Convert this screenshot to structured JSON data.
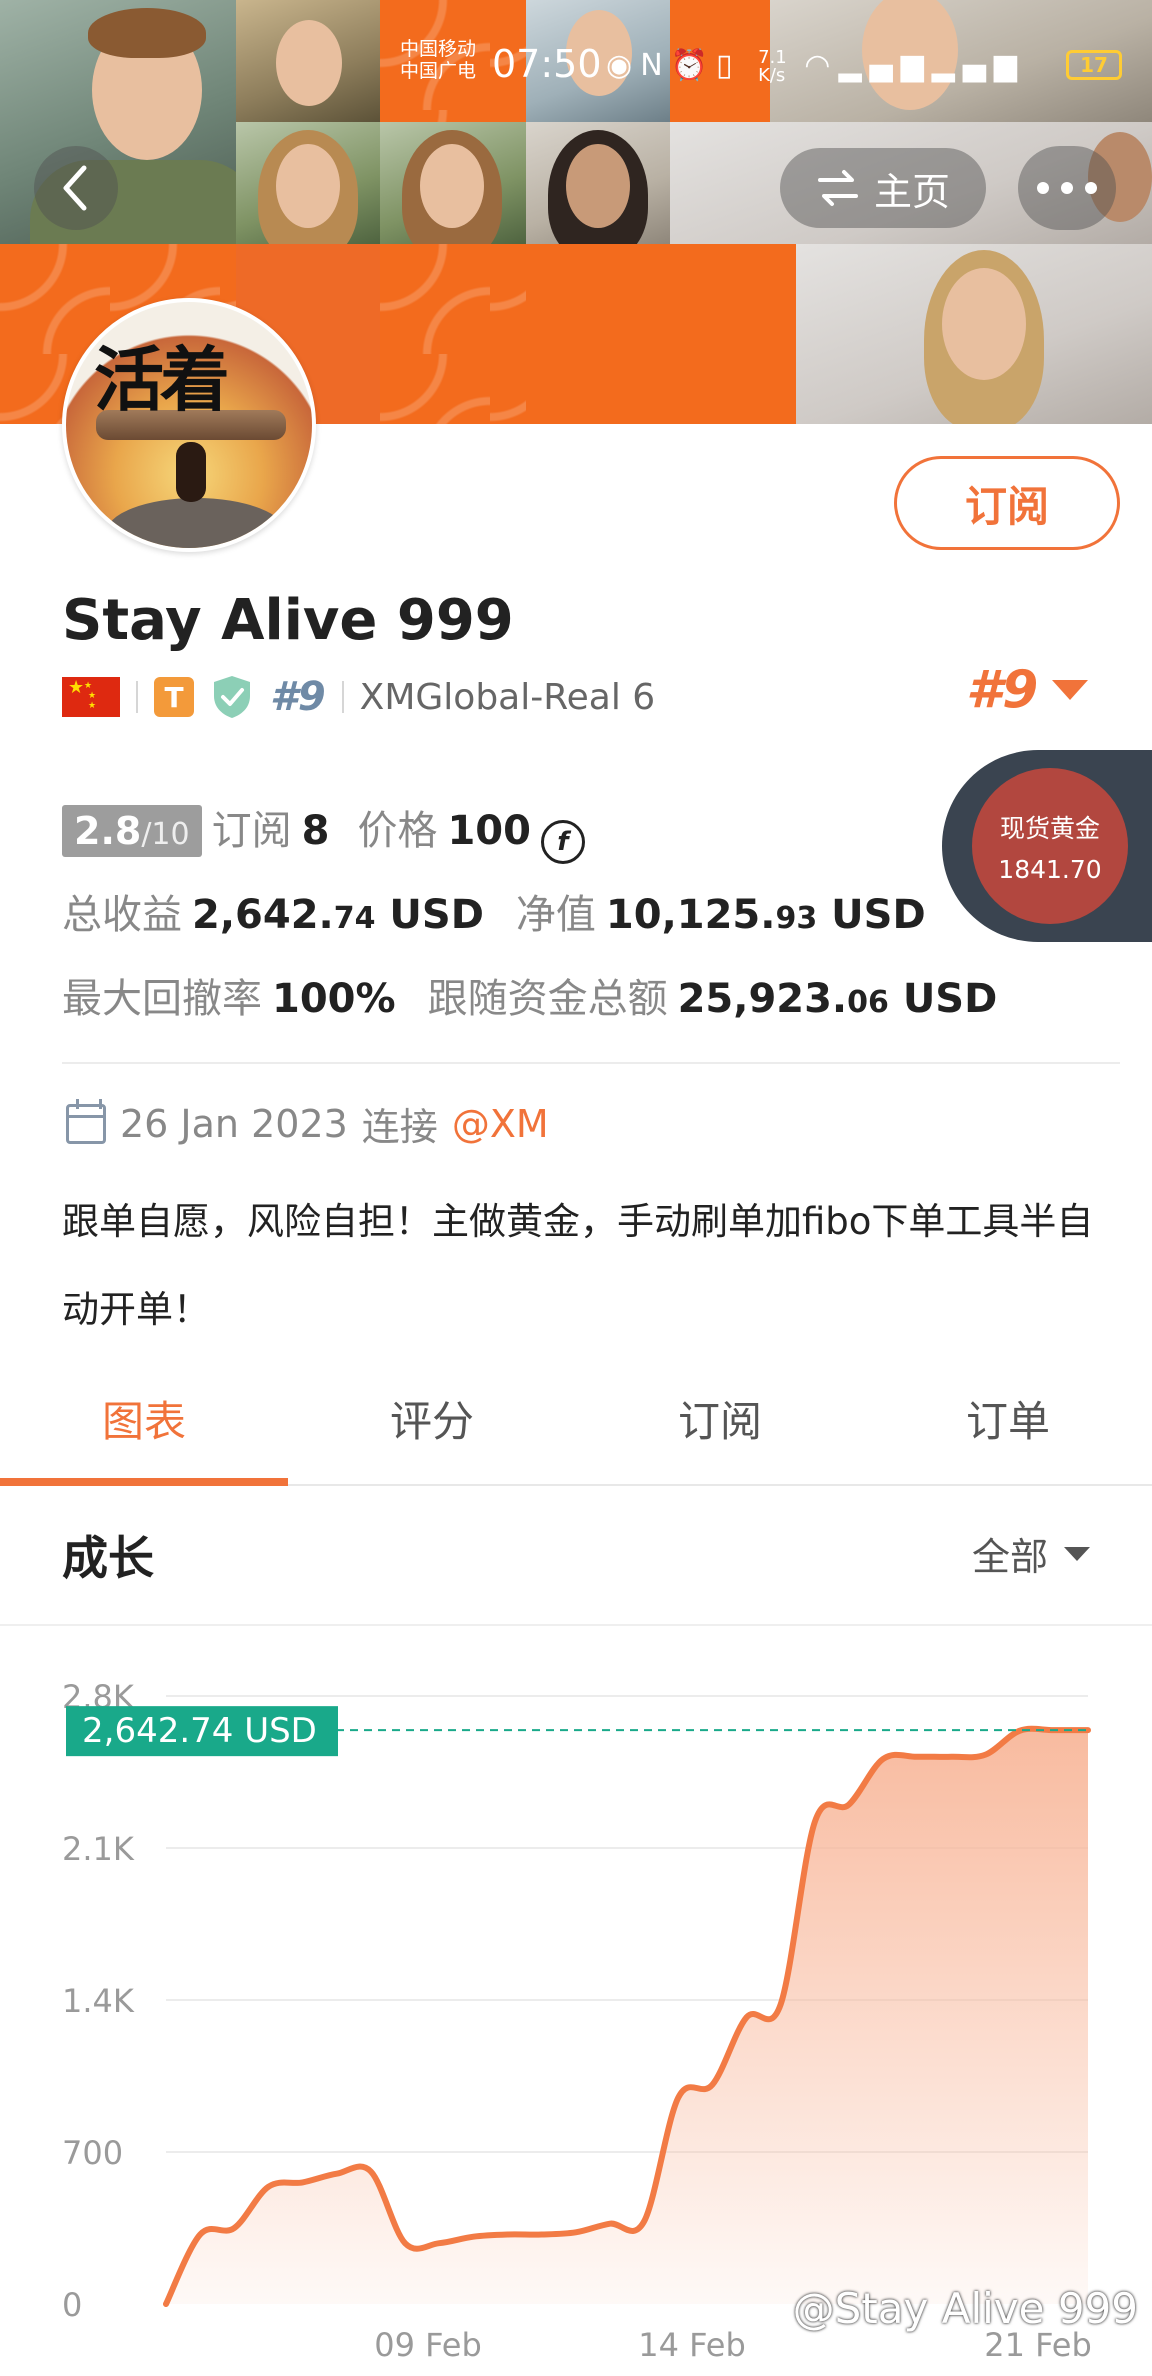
{
  "status_bar": {
    "carrier_line1": "中国移动",
    "carrier_line2": "中国广电",
    "time": "07:50",
    "net_speed": "7.1\nK/s",
    "battery": "17"
  },
  "nav": {
    "back_icon": "chevron-left-icon",
    "home_label": "主页",
    "more_icon": "more-horizontal-icon"
  },
  "profile": {
    "avatar_text": "活着",
    "subscribe_label": "订阅",
    "name": "Stay Alive 999",
    "flag": "china-flag",
    "t_badge": "T",
    "rank_small": "#9",
    "broker": "XMGlobal-Real 6",
    "rank_big": "#9"
  },
  "stats": {
    "score": "2.8",
    "score_max": "/10",
    "subscribe_label": "订阅",
    "subscribe_count": "8",
    "price_label": "价格",
    "price_value": "100",
    "coin_symbol": "f",
    "total_profit_label": "总收益",
    "total_profit_main": "2,642.",
    "total_profit_dec": "74",
    "total_profit_unit": "USD",
    "equity_label": "净值",
    "equity_main": "10,125.",
    "equity_dec": "93",
    "equity_unit": "USD",
    "drawdown_label": "最大回撤率",
    "drawdown_value": "100%",
    "follow_label": "跟随资金总额",
    "follow_main": "25,923.",
    "follow_dec": "06",
    "follow_unit": "USD"
  },
  "gold_widget": {
    "label": "现货黄金",
    "value": "1841.70"
  },
  "joined": {
    "date": "26 Jan 2023",
    "connect_label": "连接",
    "broker_link": "@XM"
  },
  "bio": "跟单自愿，风险自担！主做黄金，手动刷单加fibo下单工具半自动开单！",
  "tabs": [
    {
      "label": "图表",
      "active": true
    },
    {
      "label": "评分",
      "active": false
    },
    {
      "label": "订阅",
      "active": false
    },
    {
      "label": "订单",
      "active": false
    }
  ],
  "growth": {
    "title": "成长",
    "range": "全部"
  },
  "chart_data": {
    "type": "area",
    "current_value_label": "2,642.74 USD",
    "current_value": 2642.74,
    "y_ticks": [
      "0",
      "700",
      "1.4K",
      "2.1K",
      "2.8K"
    ],
    "y_tick_values": [
      0,
      700,
      1400,
      2100,
      2800
    ],
    "x_ticks": [
      "09 Feb",
      "14 Feb",
      "21 Feb"
    ],
    "ylim": [
      0,
      2800
    ],
    "grid": true,
    "line_color": "#f27b45",
    "fill_color": "#f8b79a",
    "marker_color": "#19a98a",
    "series": [
      {
        "values": [
          0,
          320,
          350,
          540,
          560,
          600,
          610,
          280,
          280,
          310,
          320,
          320,
          330,
          370,
          380,
          950,
          1010,
          1320,
          1380,
          2220,
          2300,
          2510,
          2520,
          2520,
          2530,
          2640,
          2642.74,
          2642.74
        ]
      }
    ]
  },
  "watermark": "@Stay Alive 999"
}
